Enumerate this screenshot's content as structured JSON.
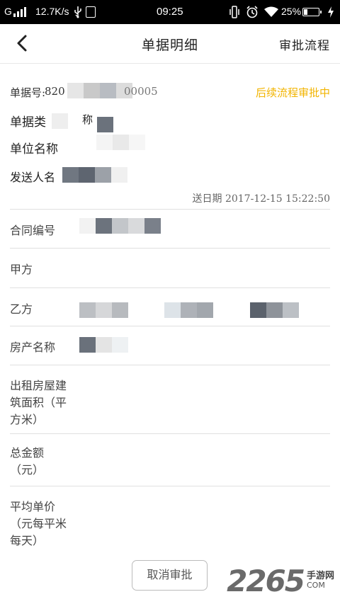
{
  "status_bar": {
    "carrier": "G",
    "net_speed": "12.7K/s",
    "time": "09:25",
    "battery": "25%",
    "battery_level": 0.25,
    "icons": [
      "signal-icon",
      "usb-icon",
      "notification-icon",
      "vibrate-icon",
      "alarm-icon",
      "wifi-icon",
      "battery-icon",
      "charging-icon"
    ]
  },
  "header": {
    "title": "单据明细",
    "action_label": "审批流程"
  },
  "summary": {
    "doc_no_label": "单据号:",
    "doc_no_prefix": "820",
    "doc_no_tail": "00005",
    "status": "后续流程审批中",
    "status_color": "#f2b400",
    "doc_type_label": "单据类",
    "doc_type_tail": "称",
    "unit_label": "单位名称",
    "sender_label": "发送人名",
    "send_date": "送日期 2017-12-15 15:22:50"
  },
  "fields": [
    {
      "label": "合同编号"
    },
    {
      "label": "甲方"
    },
    {
      "label": "乙方"
    },
    {
      "label": "房产名称"
    },
    {
      "label": "出租房屋建\n筑面积（平\n方米）"
    },
    {
      "label": "总金额\n（元）"
    },
    {
      "label": "平均单价\n（元每平米\n每天）"
    }
  ],
  "footer": {
    "cancel_label": "取消审批"
  },
  "watermark": {
    "number": "2265",
    "side_top": "手游网",
    "side_bottom": "COM"
  }
}
